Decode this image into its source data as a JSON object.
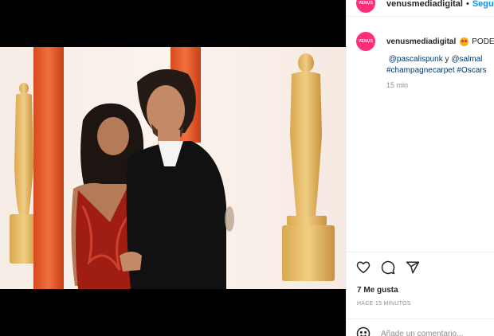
{
  "post": {
    "username": "venusmediadigital",
    "avatar_text": "VENUS",
    "separator": "•",
    "follow_label": "Seguir",
    "caption_prefix": "PODE",
    "caption_emoji": "star-struck-emoji",
    "caption_line1_start": "⁣⁣",
    "mention1": "@pascalispunk",
    "caption_line1_mid": "y",
    "mention2": "@salmal",
    "hashtag1": "#champagnecarpet",
    "hashtag2": "#Oscars",
    "caption_time": "15 min",
    "likes": "7 Me gusta",
    "posted_ago": "HACE 15 MINUTOS",
    "comment_placeholder": "Añade un comentario..."
  },
  "icons": [
    "heart-icon",
    "comment-icon",
    "share-icon",
    "emoji-icon"
  ],
  "colors": {
    "link": "#0095f6",
    "mention": "#00376b",
    "avatar_bg": "#ff2d7a",
    "muted": "#8e8e8e"
  }
}
